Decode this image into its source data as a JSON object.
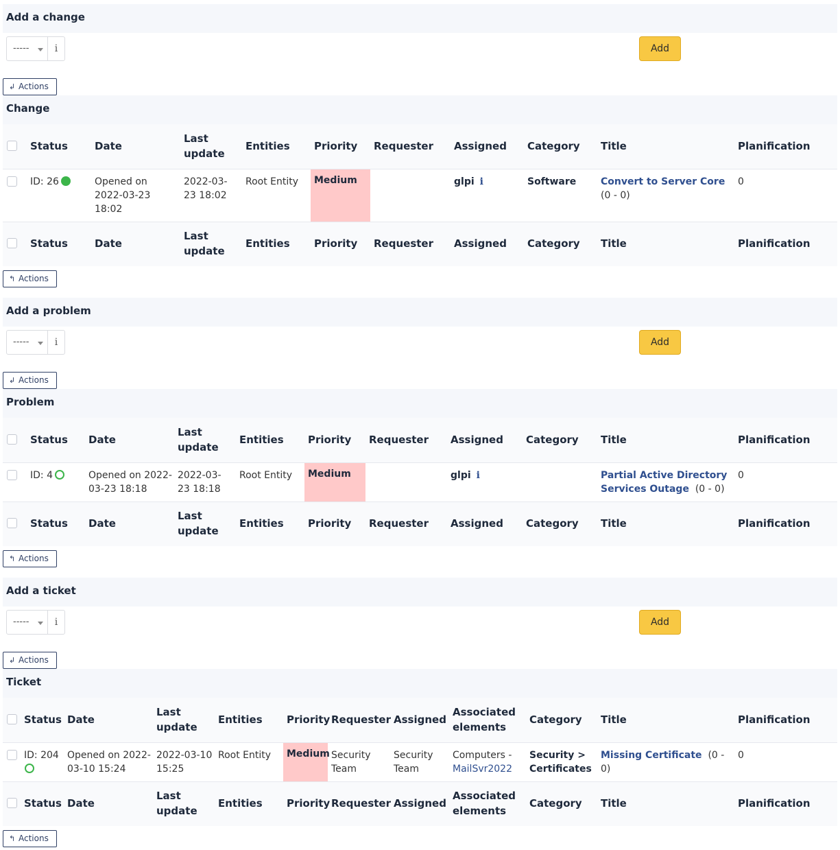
{
  "common": {
    "dropdown_value": "-----",
    "info_glyph": "i",
    "add_label": "Add",
    "actions_label": "Actions",
    "actions_icon_top": "↲",
    "actions_icon_bottom": "↰"
  },
  "columns": {
    "status": "Status",
    "date": "Date",
    "last_update": "Last update",
    "entities": "Entities",
    "priority": "Priority",
    "requester": "Requester",
    "assigned": "Assigned",
    "associated_elements": "Associated elements",
    "category": "Category",
    "title": "Title",
    "planification": "Planification"
  },
  "change": {
    "add_title": "Add a change",
    "list_title": "Change",
    "row": {
      "id": "ID: 26",
      "status_icon": "status-new-filled-icon",
      "date": "Opened on 2022-03-23 18:02",
      "last_update": "2022-03-23 18:02",
      "entity": "Root Entity",
      "priority": "Medium",
      "requester": "",
      "assigned": "glpi",
      "category": "Software",
      "title": "Convert to Server Core",
      "title_counts": "(0 - 0)",
      "planification": "0"
    }
  },
  "problem": {
    "add_title": "Add a problem",
    "list_title": "Problem",
    "row": {
      "id": "ID: 4",
      "status_icon": "status-open-circle-icon",
      "date": "Opened on 2022-03-23 18:18",
      "last_update": "2022-03-23 18:18",
      "entity": "Root Entity",
      "priority": "Medium",
      "requester": "",
      "assigned": "glpi",
      "category": "",
      "title": "Partial Active Directory Services Outage",
      "title_counts": "(0 - 0)",
      "planification": "0"
    }
  },
  "ticket": {
    "add_title": "Add a ticket",
    "list_title": "Ticket",
    "row": {
      "id": "ID: 204",
      "status_icon": "status-open-circle-icon",
      "date": "Opened on 2022-03-10 15:24",
      "last_update": "2022-03-10 15:25",
      "entity": "Root Entity",
      "priority": "Medium",
      "requester": "Security Team",
      "assigned": "Security Team",
      "assoc_prefix": "Computers -",
      "assoc_link": "MailSvr2022",
      "category": "Security > Certificates",
      "title": "Missing Certificate",
      "title_counts": "(0 - 0)",
      "planification": "0"
    }
  },
  "colors": {
    "priority_medium_bg": "#ffc9c9",
    "add_button": "#f8c843",
    "link": "#2f4f8f",
    "status_green": "#3cb54a"
  }
}
